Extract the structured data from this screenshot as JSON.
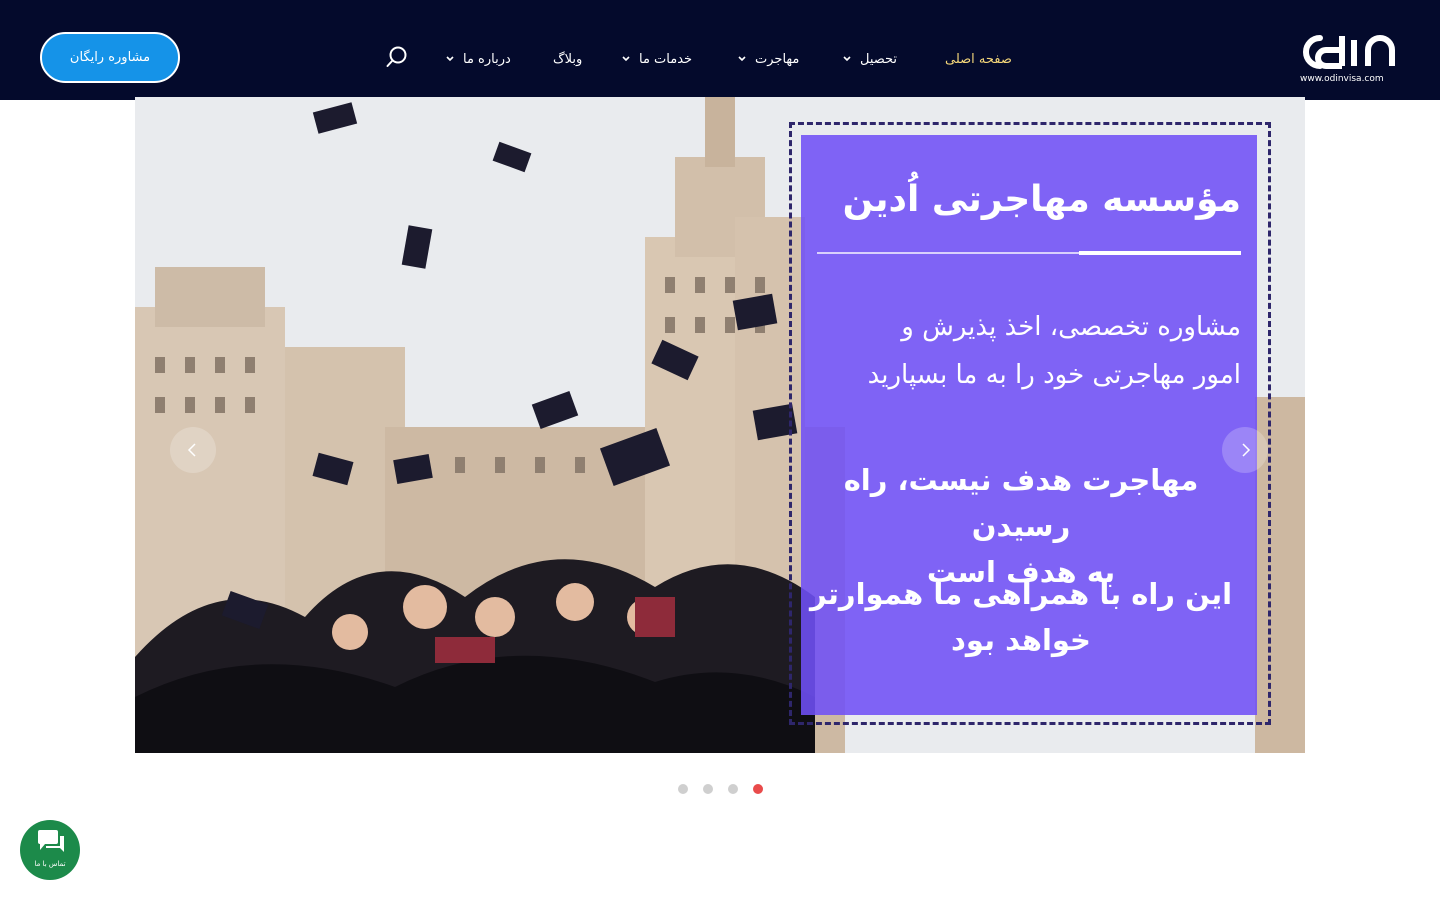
{
  "header": {
    "cta_label": "مشاوره رایگان",
    "nav": [
      {
        "label": "صفحه اصلی",
        "active": true
      },
      {
        "label": "تحصیل",
        "dropdown": true
      },
      {
        "label": "مهاجرت",
        "dropdown": true
      },
      {
        "label": "خدمات ما",
        "dropdown": true
      },
      {
        "label": "وبلاگ"
      },
      {
        "label": "درباره ما",
        "dropdown": true
      }
    ],
    "logo_url_text": "www.odinvisa.com"
  },
  "slider": {
    "title": "مؤسسه مهاجرتی اُدین",
    "subtitle_line1": "مشاوره تخصصی، اخذ پذیرش و",
    "subtitle_line2": "امور مهاجرتی خود را به ما بسپارید",
    "slogan_line1": "مهاجرت هدف نیست، راه رسیدن",
    "slogan_line2": "به هدف است",
    "closing_line1": "این راه با همراهی ما هموارتر",
    "closing_line2": "خواهد بود",
    "overlay_color": "#7050f6",
    "slides_total": 4,
    "active_slide": 1
  },
  "chat": {
    "label": "تماس با ما",
    "color": "#1c8a4a"
  },
  "colors": {
    "header_bg": "#040a2c",
    "accent": "#1593e8",
    "active_nav": "#f5d77a",
    "dot_active": "#e94b4b"
  }
}
